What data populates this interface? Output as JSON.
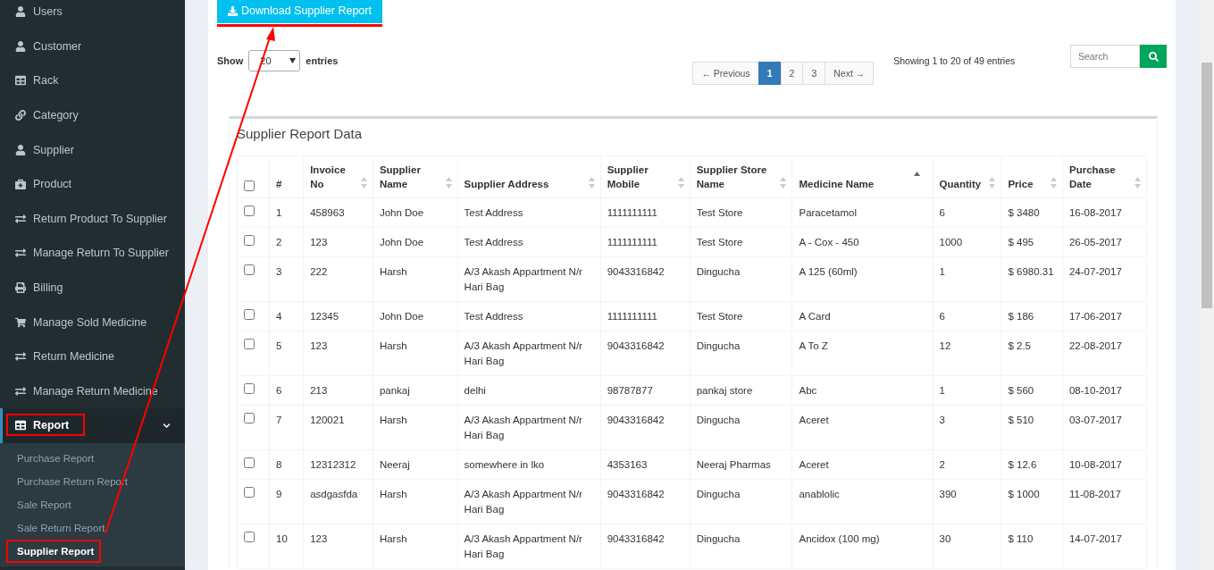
{
  "sidebar": {
    "items": [
      {
        "label": "Users",
        "selected": false
      },
      {
        "label": "Customer",
        "selected": false
      },
      {
        "label": "Rack",
        "selected": false
      },
      {
        "label": "Category",
        "selected": false
      },
      {
        "label": "Supplier",
        "selected": false
      },
      {
        "label": "Product",
        "selected": false
      },
      {
        "label": "Return Product To Supplier",
        "selected": false
      },
      {
        "label": "Manage Return To Supplier",
        "selected": false
      },
      {
        "label": "Billing",
        "selected": false
      },
      {
        "label": "Manage Sold Medicine",
        "selected": false
      },
      {
        "label": "Return Medicine",
        "selected": false
      },
      {
        "label": "Manage Return Medicine",
        "selected": false
      },
      {
        "label": "Report",
        "selected": true,
        "expanded": true,
        "annotated": true,
        "children": [
          {
            "label": "Purchase Report",
            "selected": false,
            "annotated": false
          },
          {
            "label": "Purchase Return Report",
            "selected": false,
            "annotated": false
          },
          {
            "label": "Sale Report",
            "selected": false,
            "annotated": false
          },
          {
            "label": "Sale Return Report",
            "selected": false,
            "annotated": false
          },
          {
            "label": "Supplier Report",
            "selected": true,
            "annotated": true
          }
        ]
      }
    ]
  },
  "download_button": {
    "label": "Download Supplier Report"
  },
  "length_menu": {
    "before": "Show",
    "value": "20",
    "after": "entries"
  },
  "pagination": [
    {
      "label": "← Previous",
      "selected": false
    },
    {
      "label": "1",
      "selected": true
    },
    {
      "label": "2",
      "selected": false
    },
    {
      "label": "3",
      "selected": false
    },
    {
      "label": "Next →",
      "selected": false
    }
  ],
  "info": "Showing 1 to 20 of 49 entries",
  "search": {
    "placeholder": "Search"
  },
  "panel": {
    "title": "Supplier Report Data"
  },
  "table": {
    "select_all": {
      "checked": false
    },
    "columns": [
      {
        "label": "#",
        "sortable": false,
        "sorted": false
      },
      {
        "label": "Invoice No",
        "sortable": true,
        "sorted": false
      },
      {
        "label": "Supplier Name",
        "sortable": true,
        "sorted": false
      },
      {
        "label": "Supplier Address",
        "sortable": true,
        "sorted": false
      },
      {
        "label": "Supplier Mobile",
        "sortable": true,
        "sorted": false
      },
      {
        "label": "Supplier Store Name",
        "sortable": true,
        "sorted": false
      },
      {
        "label": "Medicine Name",
        "sortable": true,
        "sorted": true
      },
      {
        "label": "Quantity",
        "sortable": true,
        "sorted": false
      },
      {
        "label": "Price",
        "sortable": true,
        "sorted": false
      },
      {
        "label": "Purchase Date",
        "sortable": true,
        "sorted": false
      }
    ],
    "rows": [
      {
        "checked": false,
        "cells": [
          "1",
          "458963",
          "John Doe",
          "Test Address",
          "1111111111",
          "Test Store",
          "Paracetamol",
          "6",
          "$ 3480",
          "16-08-2017"
        ]
      },
      {
        "checked": false,
        "cells": [
          "2",
          "123",
          "John Doe",
          "Test Address",
          "1111111111",
          "Test Store",
          "A - Cox - 450",
          "1000",
          "$ 495",
          "26-05-2017"
        ]
      },
      {
        "checked": false,
        "cells": [
          "3",
          "222",
          "Harsh",
          "A/3 Akash Appartment N/r Hari Bag",
          "9043316842",
          "Dingucha",
          "A 125 (60ml)",
          "1",
          "$ 6980.31",
          "24-07-2017"
        ]
      },
      {
        "checked": false,
        "cells": [
          "4",
          "12345",
          "John Doe",
          "Test Address",
          "1111111111",
          "Test Store",
          "A Card",
          "6",
          "$ 186",
          "17-06-2017"
        ]
      },
      {
        "checked": false,
        "cells": [
          "5",
          "123",
          "Harsh",
          "A/3 Akash Appartment N/r Hari Bag",
          "9043316842",
          "Dingucha",
          "A To Z",
          "12",
          "$ 2.5",
          "22-08-2017"
        ]
      },
      {
        "checked": false,
        "cells": [
          "6",
          "213",
          "pankaj",
          "delhi",
          "98787877",
          "pankaj store",
          "Abc",
          "1",
          "$ 560",
          "08-10-2017"
        ]
      },
      {
        "checked": false,
        "cells": [
          "7",
          "120021",
          "Harsh",
          "A/3 Akash Appartment N/r Hari Bag",
          "9043316842",
          "Dingucha",
          "Aceret",
          "3",
          "$ 510",
          "03-07-2017"
        ]
      },
      {
        "checked": false,
        "cells": [
          "8",
          "12312312",
          "Neeraj",
          "somewhere in lko",
          "4353163",
          "Neeraj Pharmas",
          "Aceret",
          "2",
          "$ 12.6",
          "10-08-2017"
        ]
      },
      {
        "checked": false,
        "cells": [
          "9",
          "asdgasfda",
          "Harsh",
          "A/3 Akash Appartment N/r Hari Bag",
          "9043316842",
          "Dingucha",
          "anablolic",
          "390",
          "$ 1000",
          "11-08-2017"
        ]
      },
      {
        "checked": false,
        "cells": [
          "10",
          "123",
          "Harsh",
          "A/3 Akash Appartment N/r Hari Bag",
          "9043316842",
          "Dingucha",
          "Ancidox (100 mg)",
          "30",
          "$ 110",
          "14-07-2017"
        ]
      }
    ]
  }
}
